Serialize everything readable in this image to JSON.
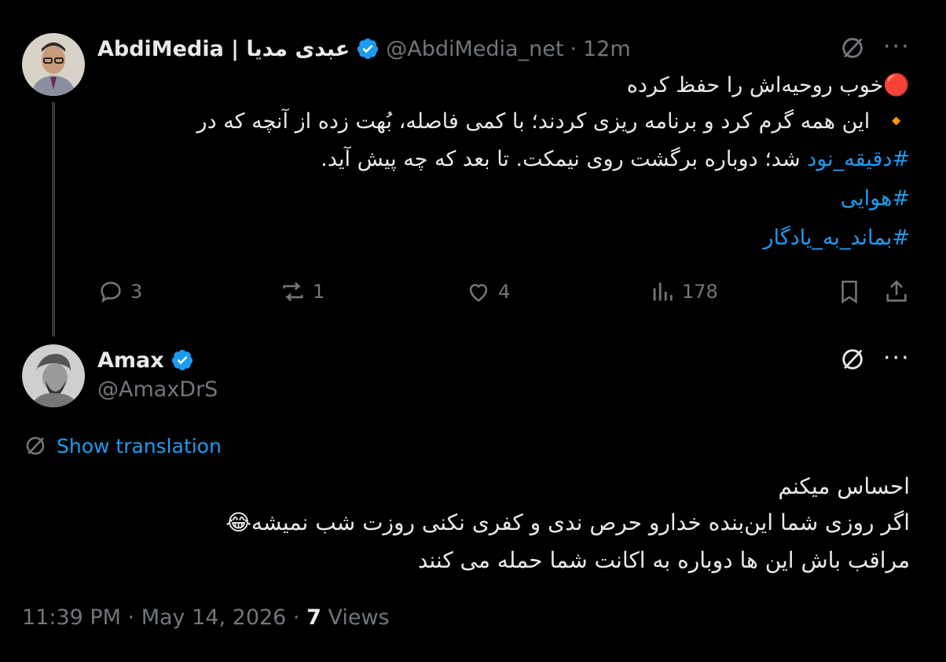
{
  "tweet1": {
    "display_name": "AbdiMedia | عبدی مدیا",
    "handle": "@AbdiMedia_net",
    "separator": "·",
    "time": "12m",
    "line1_icon": "🔴",
    "line1": "خوب روحیه‌اش را حفظ کرده",
    "line2_icon": "🔸",
    "line2": "این همه گرم کرد و برنامه ریزی کردند؛ با کمی فاصله، بُهت زده از آنچه که در",
    "line3_hashtag": "#دقیقه_نود",
    "line3_text": " شد؛ دوباره برگشت روی نیمکت. تا بعد که چه پیش آید.",
    "hashtag1": "#هوایی",
    "hashtag2": "#بماند_به_یادگار",
    "replies": "3",
    "reposts": "1",
    "likes": "4",
    "views": "178"
  },
  "tweet2": {
    "display_name": "Amax",
    "handle": "@AmaxDrS",
    "show_translation": "Show translation",
    "line1": "احساس میکنم",
    "line2": "اگر روزی شما این‌بنده خدارو حرص ندی و کفری نکنی روزت شب نمیشه😂",
    "line3": "مراقب باش این ها دوباره به اکانت شما حمله می کنند",
    "timestamp": "11:39 PM · May 14, 2026 · ",
    "view_count": "7",
    "views_label": " Views"
  },
  "icons": {
    "verified": "verified-badge-icon",
    "grok": "grok-icon",
    "more": "more-icon",
    "reply": "reply-icon",
    "repost": "repost-icon",
    "like": "like-icon",
    "views": "views-icon",
    "bookmark": "bookmark-icon",
    "share": "share-icon"
  },
  "colors": {
    "accent": "#1d9bf0",
    "muted": "#71767b",
    "text": "#e7e9ea",
    "background": "#000000"
  }
}
